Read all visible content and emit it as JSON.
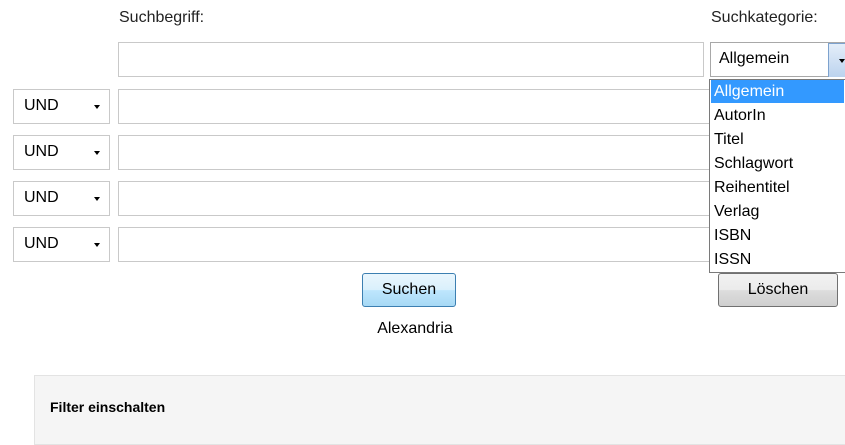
{
  "search": {
    "term_label": "Suchbegriff:",
    "category_label": "Suchkategorie:",
    "main_input_value": "",
    "category_selected": "Allgemein",
    "category_options": [
      "Allgemein",
      "AutorIn",
      "Titel",
      "Schlagwort",
      "Reihentitel",
      "Verlag",
      "ISBN",
      "ISSN"
    ],
    "rows": [
      {
        "operator": "UND",
        "value": ""
      },
      {
        "operator": "UND",
        "value": ""
      },
      {
        "operator": "UND",
        "value": ""
      },
      {
        "operator": "UND",
        "value": ""
      }
    ]
  },
  "buttons": {
    "search_label": "Suchen",
    "clear_label": "Löschen"
  },
  "footer": {
    "brand": "Alexandria"
  },
  "filter": {
    "title": "Filter einschalten"
  }
}
